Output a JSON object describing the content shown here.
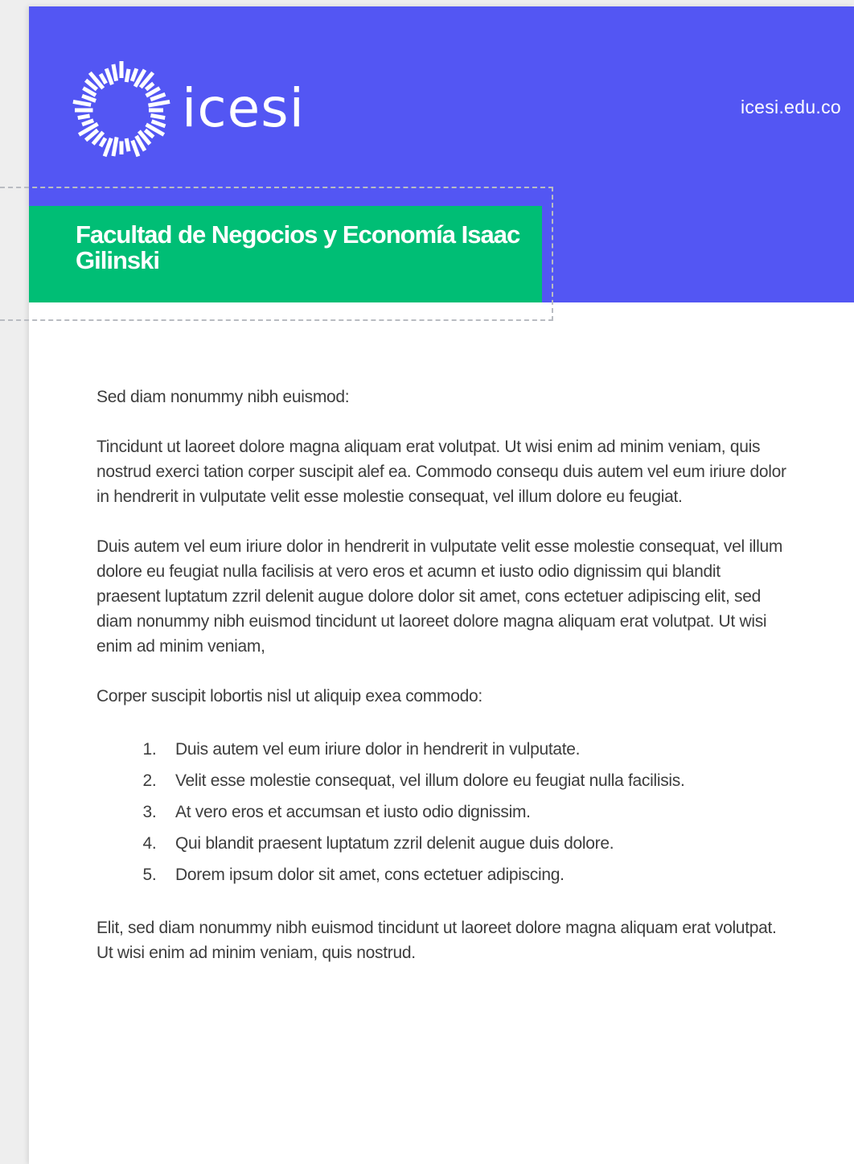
{
  "header": {
    "logo_text": "icesi",
    "website": "icesi.edu.co",
    "faculty": "Facultad de Negocios y Economía Isaac Gilinski"
  },
  "body": {
    "intro": "Sed diam nonummy nibh euismod:",
    "paragraph1": "Tincidunt ut laoreet dolore magna aliquam erat volutpat. Ut wisi enim ad minim veniam, quis nostrud exerci tation corper suscipit  alef ea. Commodo consequ duis autem vel eum iriure dolor in hendrerit in vulputate velit esse molestie consequat, vel illum dolore eu feugiat.",
    "paragraph2": "Duis autem vel eum iriure dolor in hendrerit in vulputate velit esse molestie consequat, vel illum dolore eu feugiat nulla facilisis at vero eros et acumn et iusto odio dignissim qui blandit praesent luptatum zzril delenit augue dolore dolor sit amet, cons ectetuer adipiscing elit, sed diam nonummy nibh euismod tincidunt ut laoreet dolore magna aliquam erat volutpat. Ut wisi enim ad minim veniam,",
    "list_intro": "Corper suscipit lobortis nisl ut aliquip exea commodo:",
    "list": [
      "Duis autem vel eum iriure dolor in hendrerit in vulputate.",
      "Velit esse molestie consequat, vel illum dolore eu feugiat nulla facilisis.",
      "At vero eros et accumsan et iusto odio dignissim.",
      "Qui blandit praesent luptatum zzril delenit augue duis dolore.",
      "Dorem ipsum dolor sit amet, cons ectetuer adipiscing."
    ],
    "closing": "Elit, sed diam nonummy nibh euismod tincidunt ut laoreet dolore magna aliquam erat volutpat. Ut wisi enim ad minim veniam, quis nostrud."
  },
  "colors": {
    "header_blue": "#5356f3",
    "faculty_green": "#00be75",
    "text": "#3d3d3d"
  },
  "icons": {
    "logo": "sunburst-logo-icon"
  }
}
